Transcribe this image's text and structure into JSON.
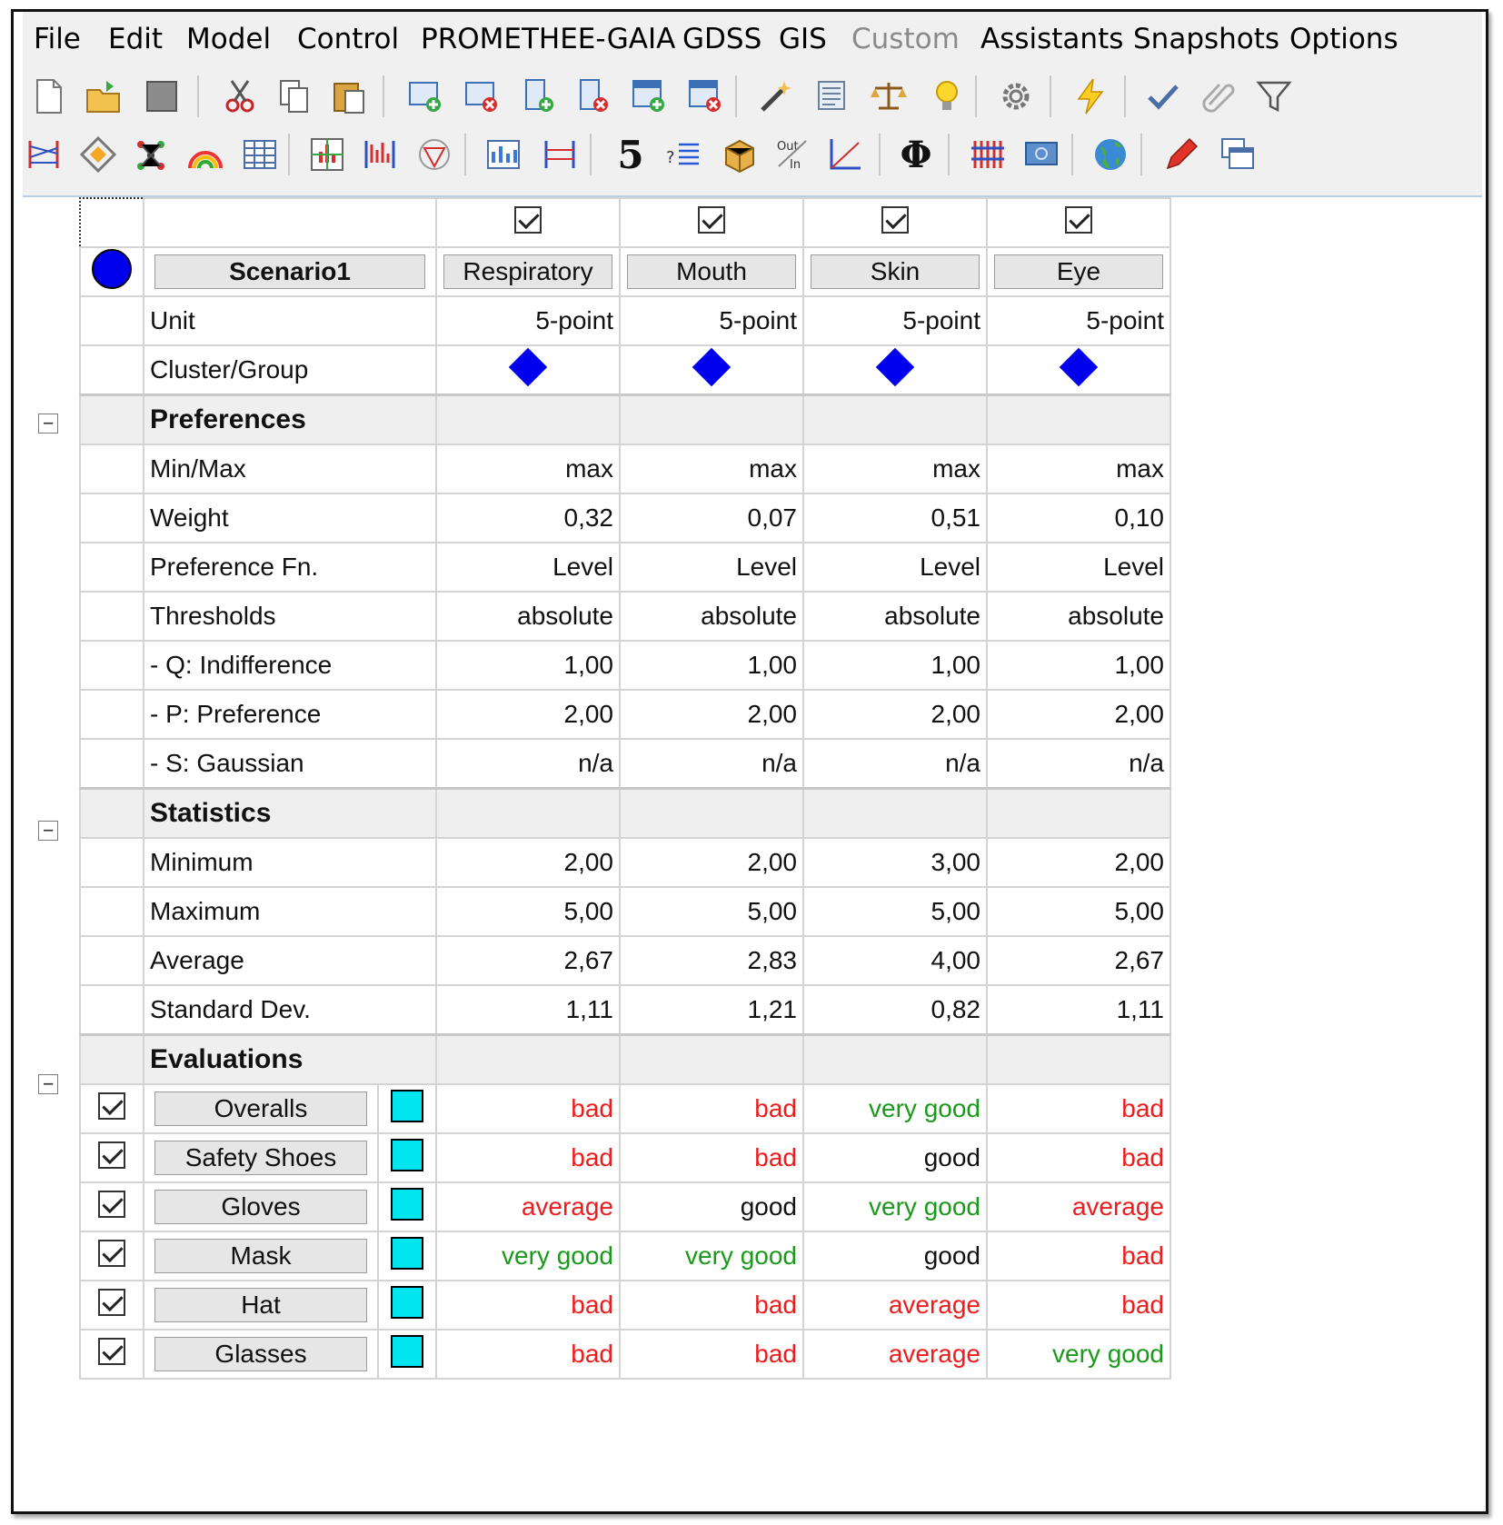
{
  "menu": [
    "File",
    "Edit",
    "Model",
    "Control",
    "PROMETHEE-GAIA",
    "GDSS",
    "GIS",
    "Custom",
    "Assistants",
    "Snapshots",
    "Options"
  ],
  "menu_disabled": [
    "Custom"
  ],
  "toolbar1_icons": [
    "new-file-icon",
    "open-folder-icon",
    "save-icon",
    "cut-icon",
    "copy-icon",
    "paste-icon",
    "add-action-icon",
    "delete-action-icon",
    "add-criterion-icon",
    "delete-criterion-icon",
    "add-scenario-icon",
    "delete-scenario-icon",
    "edit-wand-icon",
    "visual-stability-icon",
    "balance-icon",
    "lightbulb-icon",
    "settings-gear-icon",
    "lightning-icon",
    "checkmark-icon",
    "paperclip-icon",
    "filter-icon"
  ],
  "toolbar2_icons": [
    "ranking-icon",
    "diamond-icon",
    "network-icon",
    "rainbow-icon",
    "table-icon",
    "walking-weights-icon",
    "profiles-icon",
    "gaia-icon",
    "pie-chart-icon",
    "bars-icon",
    "number-five-icon",
    "list-icon",
    "boxes-icon",
    "out-in-icon",
    "curve-icon",
    "phi-icon",
    "colored-bars-icon",
    "screen-icon",
    "globe-icon",
    "pencil-icon",
    "windows-icon"
  ],
  "toolbar2_texts": {
    "five": "5",
    "phi": "Φ"
  },
  "scenario": "Scenario1",
  "criteria": [
    "Respiratory",
    "Mouth",
    "Skin",
    "Eye"
  ],
  "unit_label": "Unit",
  "units": [
    "5-point",
    "5-point",
    "5-point",
    "5-point"
  ],
  "cluster_label": "Cluster/Group",
  "preferences": {
    "title": "Preferences",
    "rows": [
      {
        "label": "Min/Max",
        "values": [
          "max",
          "max",
          "max",
          "max"
        ]
      },
      {
        "label": "Weight",
        "values": [
          "0,32",
          "0,07",
          "0,51",
          "0,10"
        ]
      },
      {
        "label": "Preference Fn.",
        "values": [
          "Level",
          "Level",
          "Level",
          "Level"
        ]
      },
      {
        "label": "Thresholds",
        "values": [
          "absolute",
          "absolute",
          "absolute",
          "absolute"
        ]
      },
      {
        "label": "- Q: Indifference",
        "values": [
          "1,00",
          "1,00",
          "1,00",
          "1,00"
        ]
      },
      {
        "label": "- P: Preference",
        "values": [
          "2,00",
          "2,00",
          "2,00",
          "2,00"
        ]
      },
      {
        "label": "- S: Gaussian",
        "values": [
          "n/a",
          "n/a",
          "n/a",
          "n/a"
        ]
      }
    ]
  },
  "statistics": {
    "title": "Statistics",
    "rows": [
      {
        "label": "Minimum",
        "values": [
          "2,00",
          "2,00",
          "3,00",
          "2,00"
        ]
      },
      {
        "label": "Maximum",
        "values": [
          "5,00",
          "5,00",
          "5,00",
          "5,00"
        ]
      },
      {
        "label": "Average",
        "values": [
          "2,67",
          "2,83",
          "4,00",
          "2,67"
        ]
      },
      {
        "label": "Standard Dev.",
        "values": [
          "1,11",
          "1,21",
          "0,82",
          "1,11"
        ]
      }
    ]
  },
  "evaluations": {
    "title": "Evaluations",
    "rows": [
      {
        "name": "Overalls",
        "values": [
          "bad",
          "bad",
          "very good",
          "bad"
        ]
      },
      {
        "name": "Safety Shoes",
        "values": [
          "bad",
          "bad",
          "good",
          "bad"
        ]
      },
      {
        "name": "Gloves",
        "values": [
          "average",
          "good",
          "very good",
          "average"
        ]
      },
      {
        "name": "Mask",
        "values": [
          "very good",
          "very good",
          "good",
          "bad"
        ]
      },
      {
        "name": "Hat",
        "values": [
          "bad",
          "bad",
          "average",
          "bad"
        ]
      },
      {
        "name": "Glasses",
        "values": [
          "bad",
          "bad",
          "average",
          "very good"
        ]
      }
    ]
  },
  "colors": {
    "bad": "#ee1c1c",
    "average": "#ee1c1c",
    "good": "#111111",
    "very good": "#1a9a1a",
    "cluster": "#0000ee",
    "action": "#00e5ee"
  }
}
